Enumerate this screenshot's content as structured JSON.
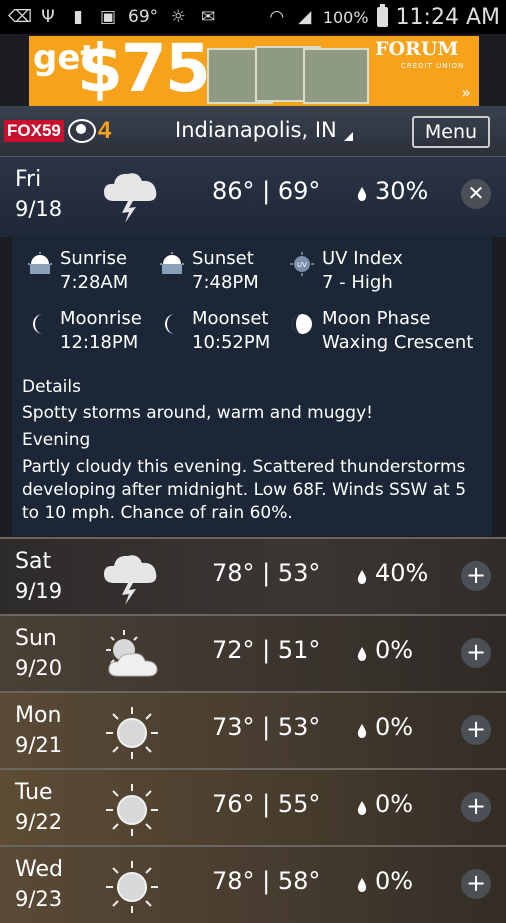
{
  "status_bar": {
    "temp": "69°",
    "battery": "100%",
    "time": "11:24 AM"
  },
  "ad": {
    "get": "get",
    "amount": "$75",
    "brand": "FORUM",
    "sub": "CREDIT UNION",
    "arrow": "»"
  },
  "header": {
    "logo_fox": "FOX",
    "logo_num": "59",
    "logo_four": "4",
    "location": "Indianapolis, IN",
    "menu": "Menu"
  },
  "today": {
    "day": "Fri",
    "date": "9/18",
    "temps": "86° | 69°",
    "rain": "30%",
    "toggle": "✕",
    "astro": [
      {
        "label": "Sunrise",
        "value": "7:28AM",
        "icon": "sunrise-icon"
      },
      {
        "label": "Sunset",
        "value": "7:48PM",
        "icon": "sunset-icon"
      },
      {
        "label": "UV Index",
        "value": "7 - High",
        "icon": "uv-index-icon"
      },
      {
        "label": "Moonrise",
        "value": "12:18PM",
        "icon": "moonrise-icon"
      },
      {
        "label": "Moonset",
        "value": "10:52PM",
        "icon": "moonset-icon"
      },
      {
        "label": "Moon Phase",
        "value": "Waxing Crescent",
        "icon": "moon-phase-icon"
      }
    ],
    "details_title": "Details",
    "details_text": "Spotty storms around, warm and muggy!",
    "evening_title": "Evening",
    "evening_text": "Partly cloudy this evening. Scattered thunderstorms developing after midnight. Low 68F. Winds SSW at 5 to 10 mph. Chance of rain 60%."
  },
  "forecast": [
    {
      "day": "Sat",
      "date": "9/19",
      "temps": "78° | 53°",
      "rain": "40%",
      "icon": "thunderstorm-icon",
      "toggle": "+"
    },
    {
      "day": "Sun",
      "date": "9/20",
      "temps": "72° | 51°",
      "rain": "0%",
      "icon": "partly-cloudy-icon",
      "toggle": "+"
    },
    {
      "day": "Mon",
      "date": "9/21",
      "temps": "73° | 53°",
      "rain": "0%",
      "icon": "sunny-icon",
      "toggle": "+"
    },
    {
      "day": "Tue",
      "date": "9/22",
      "temps": "76° | 55°",
      "rain": "0%",
      "icon": "sunny-icon",
      "toggle": "+"
    },
    {
      "day": "Wed",
      "date": "9/23",
      "temps": "78° | 58°",
      "rain": "0%",
      "icon": "sunny-icon",
      "toggle": "+"
    }
  ]
}
